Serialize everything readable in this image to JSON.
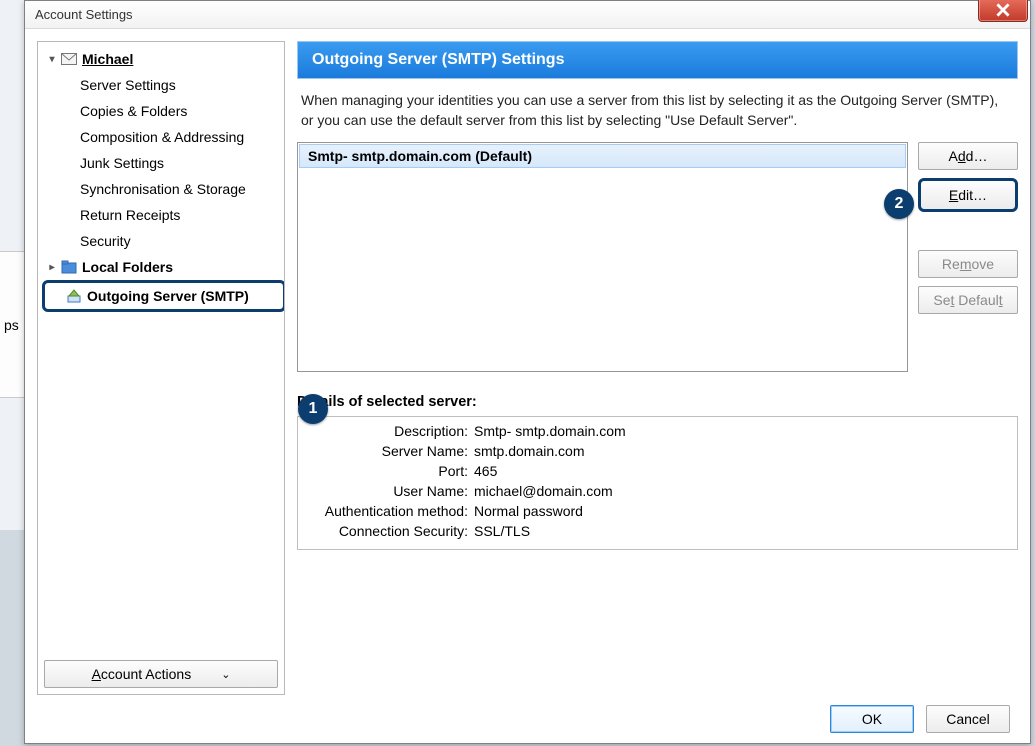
{
  "window": {
    "title": "Account Settings"
  },
  "sidebar": {
    "account": "Michael",
    "items": [
      "Server Settings",
      "Copies & Folders",
      "Composition & Addressing",
      "Junk Settings",
      "Synchronisation & Storage",
      "Return Receipts",
      "Security"
    ],
    "local_folders": "Local Folders",
    "outgoing": "Outgoing Server (SMTP)",
    "account_actions": "Account Actions"
  },
  "panel": {
    "header": "Outgoing Server (SMTP) Settings",
    "description": "When managing your identities you can use a server from this list by selecting it as the Outgoing Server (SMTP), or you can use the default server from this list by selecting \"Use Default Server\"."
  },
  "server_list": {
    "selected": "Smtp- smtp.domain.com (Default)"
  },
  "buttons": {
    "add": "Add...",
    "edit": "Edit...",
    "remove": "Remove",
    "set_default": "Set Default",
    "ok": "OK",
    "cancel": "Cancel"
  },
  "details": {
    "title": "Details of selected server:",
    "labels": {
      "description": "Description:",
      "server_name": "Server Name:",
      "port": "Port:",
      "user_name": "User Name:",
      "auth_method": "Authentication method:",
      "conn_sec": "Connection Security:"
    },
    "values": {
      "description": "Smtp- smtp.domain.com",
      "server_name": "smtp.domain.com",
      "port": "465",
      "user_name": "michael@domain.com",
      "auth_method": "Normal password",
      "conn_sec": "SSL/TLS"
    }
  },
  "callouts": {
    "one": "1",
    "two": "2"
  }
}
